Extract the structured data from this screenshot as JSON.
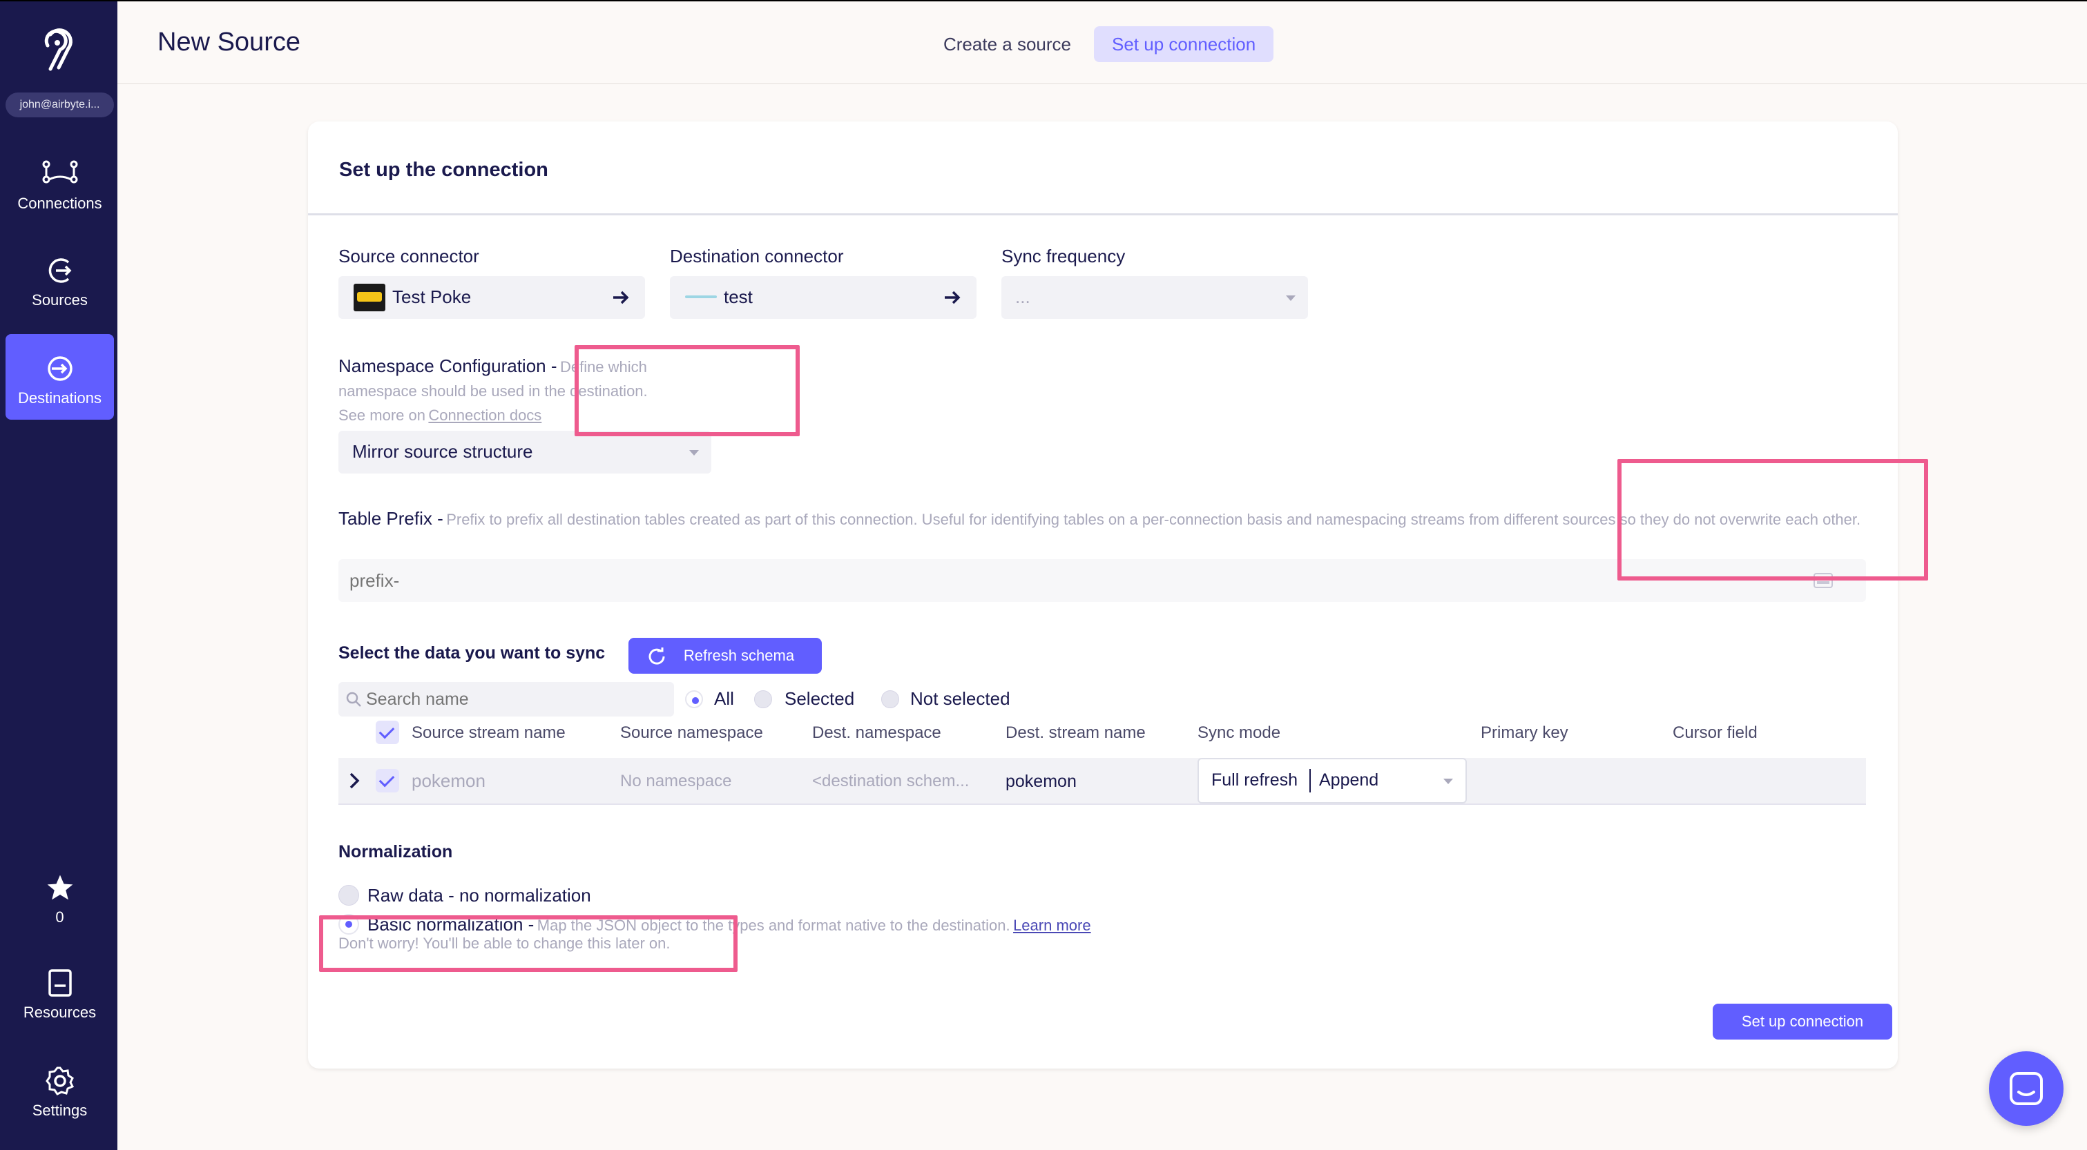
{
  "sidebar": {
    "user": "john@airbyte.i...",
    "items": [
      {
        "label": "Connections",
        "icon": "connections-icon"
      },
      {
        "label": "Sources",
        "icon": "sources-icon"
      },
      {
        "label": "Destinations",
        "icon": "destinations-icon"
      }
    ],
    "bottom": [
      {
        "label": "0",
        "icon": "star-icon"
      },
      {
        "label": "Resources",
        "icon": "book-icon"
      },
      {
        "label": "Settings",
        "icon": "gear-icon"
      }
    ]
  },
  "header": {
    "title": "New Source",
    "steps": [
      "Create a source",
      "Set up connection"
    ]
  },
  "card": {
    "title": "Set up the connection",
    "source_label": "Source connector",
    "source_value": "Test Poke",
    "dest_label": "Destination connector",
    "dest_value": "test",
    "sync_label": "Sync frequency",
    "sync_value": "...",
    "namespace_label": "Namespace Configuration -",
    "namespace_hint": "Define which namespace should be used in the destination.",
    "namespace_see_more": "See more on",
    "namespace_link": "Connection docs",
    "namespace_value": "Mirror source structure",
    "prefix_label": "Table Prefix -",
    "prefix_hint": "Prefix to prefix all destination tables created as part of this connection. Useful for identifying tables on a per-connection basis and namespacing streams from different sources so they do not overwrite each other.",
    "prefix_placeholder": "prefix-",
    "select_label": "Select the data you want to sync",
    "refresh_button": "Refresh schema",
    "search_placeholder": "Search name",
    "filters": [
      "All",
      "Selected",
      "Not selected"
    ],
    "columns": [
      "Source stream name",
      "Source namespace",
      "Dest. namespace",
      "Dest. stream name",
      "Sync mode",
      "Primary key",
      "Cursor field"
    ],
    "rows": [
      {
        "stream": "pokemon",
        "namespace": "No namespace",
        "dest_namespace": "<destination schem...",
        "dest_stream": "pokemon",
        "sync_mode_left": "Full refresh",
        "sync_mode_right": "Append"
      }
    ],
    "normalization_title": "Normalization",
    "norm_raw": "Raw data - no normalization",
    "norm_basic": "Basic normalization -",
    "norm_basic_hint": "Map the JSON object to the types and format native to the destination.",
    "norm_learn_more": "Learn more",
    "norm_note": "Don't worry! You'll be able to change this later on.",
    "submit_button": "Set up connection"
  },
  "colors": {
    "accent": "#615eff",
    "sidebar": "#1a194d",
    "annotation": "#ee5b8e"
  }
}
